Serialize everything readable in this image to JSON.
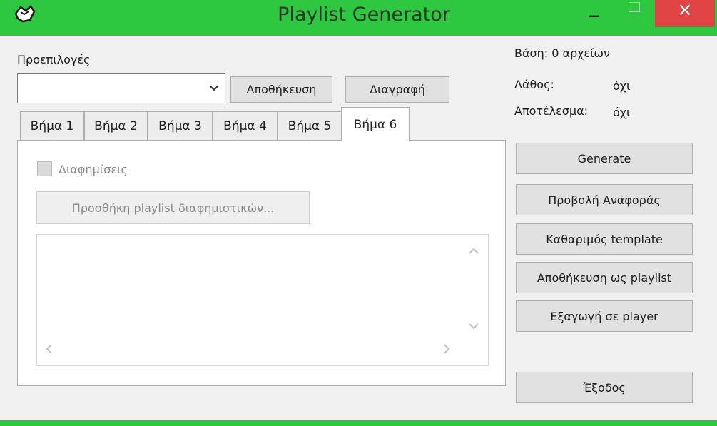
{
  "window": {
    "title": "Playlist Generator",
    "close_glyph": "×",
    "minimize_glyph": "–"
  },
  "presets": {
    "label": "Προεπιλογές",
    "selected": "",
    "save_label": "Αποθήκευση",
    "delete_label": "Διαγραφή"
  },
  "status": {
    "db_text": "Βάση: 0 αρχείων",
    "error_label": "Λάθος:",
    "error_value": "όχι",
    "result_label": "Αποτέλεσμα:",
    "result_value": "όχι"
  },
  "tabs": [
    "Βήμα 1",
    "Βήμα 2",
    "Βήμα 3",
    "Βήμα 4",
    "Βήμα 5",
    "Βήμα 6"
  ],
  "active_tab": "Βήμα 6",
  "step6": {
    "ads_checkbox_label": "Διαφημίσεις",
    "ads_checkbox_checked": false,
    "add_playlist_button": "Προσθήκη playlist διαφημιστικών...",
    "playlist_items": []
  },
  "actions": {
    "generate": "Generate",
    "view_report": "Προβολή Αναφοράς",
    "clear_template": "Καθαριμός template",
    "save_as_playlist": "Αποθήκευση ως playlist",
    "export_to_player": "Εξαγωγή σε player",
    "exit": "Έξοδος"
  },
  "colors": {
    "titlebar": "#2ec740",
    "close": "#e04343",
    "window_bg": "#f0f0f0"
  },
  "icons": [
    "app-icon",
    "minimize-icon",
    "maximize-icon",
    "close-icon",
    "chevron-down-icon",
    "scroll-up-icon",
    "scroll-down-icon",
    "scroll-left-icon",
    "scroll-right-icon"
  ]
}
